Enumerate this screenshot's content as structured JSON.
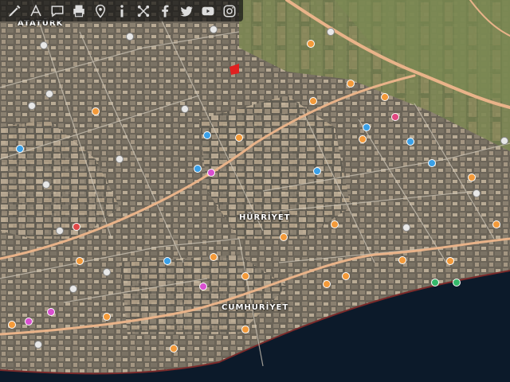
{
  "toolbar": {
    "tools": [
      {
        "name": "edit-icon",
        "label": "Draw"
      },
      {
        "name": "measure-icon",
        "label": "Measure"
      },
      {
        "name": "comment-icon",
        "label": "Comment"
      },
      {
        "name": "print-icon",
        "label": "Print"
      },
      {
        "name": "location-icon",
        "label": "Location"
      },
      {
        "name": "info-icon",
        "label": "Info"
      },
      {
        "name": "share-icon",
        "label": "Share"
      },
      {
        "name": "facebook-icon",
        "label": "Facebook"
      },
      {
        "name": "twitter-icon",
        "label": "Twitter"
      },
      {
        "name": "youtube-icon",
        "label": "YouTube"
      },
      {
        "name": "instagram-icon",
        "label": "Instagram"
      }
    ]
  },
  "labels": {
    "ataturk": "ATATÜRK",
    "hurriyet": "HÜRRİYET",
    "cumhuriyet": "CUMHURİYET"
  },
  "colors": {
    "poi_orange": "#f39a3a",
    "poi_blue": "#3aa0e8",
    "poi_white": "#e8e8e8",
    "poi_pink": "#d94fd0",
    "poi_red": "#e04848",
    "poi_green": "#35b86a",
    "road": "#e9b389",
    "sea": "#0c1a2a"
  }
}
